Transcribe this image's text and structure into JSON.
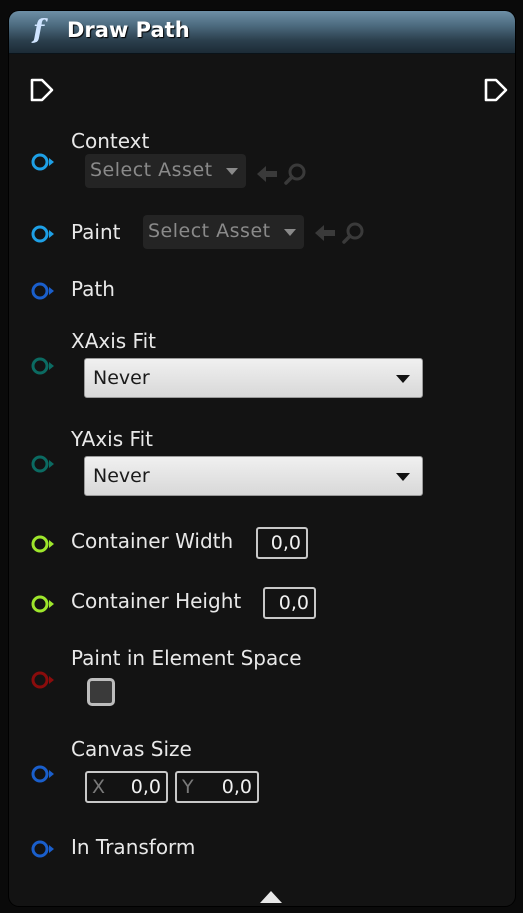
{
  "node": {
    "function_icon": "f",
    "title": "Draw Path"
  },
  "pins": {
    "context": {
      "label": "Context",
      "asset_value": "Select Asset",
      "color": "#1ea0e6"
    },
    "paint": {
      "label": "Paint",
      "asset_value": "Select Asset",
      "color": "#1ea0e6"
    },
    "path": {
      "label": "Path",
      "color": "#1a5fcc"
    },
    "xaxis_fit": {
      "label": "XAxis Fit",
      "value": "Never",
      "color": "#0b6b62"
    },
    "yaxis_fit": {
      "label": "YAxis Fit",
      "value": "Never",
      "color": "#0b6b62"
    },
    "container_width": {
      "label": "Container Width",
      "value": "0,0",
      "color": "#9ee62c"
    },
    "container_height": {
      "label": "Container Height",
      "value": "0,0",
      "color": "#9ee62c"
    },
    "paint_in_element_space": {
      "label": "Paint in Element Space",
      "checked": false,
      "color": "#8a0c0c"
    },
    "canvas_size": {
      "label": "Canvas Size",
      "x_axis": "X",
      "x_value": "0,0",
      "y_axis": "Y",
      "y_value": "0,0",
      "color": "#1a5fcc"
    },
    "in_transform": {
      "label": "In Transform",
      "color": "#1a5fcc"
    }
  },
  "icons": {
    "exec_in": "exec-in-icon",
    "exec_out": "exec-out-icon",
    "use_selected": "left-arrow-icon",
    "browse": "search-icon",
    "collapse": "collapse-arrow-icon"
  }
}
